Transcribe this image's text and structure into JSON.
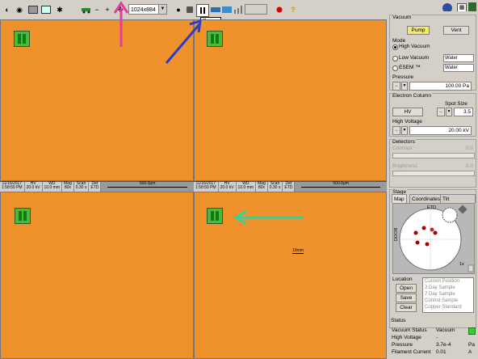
{
  "toolbar": {
    "resolution": "1024x884",
    "tooltip": "Pause",
    "icons": [
      "beam-icon",
      "eye-icon",
      "snapshot-icon",
      "image-icon",
      "settings-icon",
      "car-icon",
      "minus-icon",
      "plus-icon"
    ]
  },
  "quads": [
    {
      "databar": {
        "date": "11/16/2017",
        "time": "1:58:50 PM",
        "hv_h": "HV",
        "hv": "20.0 kV",
        "wd_h": "WD",
        "wd": "10.0 mm",
        "mag_h": "Mag",
        "mag": "80x",
        "scan_h": "Scan",
        "scan": "0.30 s",
        "det_h": "Det",
        "det": "ETD",
        "scale": "500.0μm"
      }
    },
    {
      "databar": {
        "date": "11/16/2017",
        "time": "1:58:50 PM",
        "hv_h": "HV",
        "hv": "20.0 kV",
        "wd_h": "WD",
        "wd": "10.0 mm",
        "mag_h": "Mag",
        "mag": "80x",
        "scan_h": "Scan",
        "scan": "0.30 s",
        "det_h": "Det",
        "det": "ETD",
        "scale": "500.0μm"
      }
    },
    {
      "overlay": "10mm"
    }
  ],
  "vacuum": {
    "title": "Vacuum",
    "pump": "Pump",
    "vent": "Vent",
    "mode_label": "Mode",
    "high_vacuum": "High Vacuum",
    "low_vacuum": "Low Vacuum",
    "esem": "ESEM ™",
    "water1": "Water",
    "water2": "Water",
    "pressure_label": "Pressure",
    "pressure": "100.00 Pa"
  },
  "electron_column": {
    "title": "Electron Column",
    "spot_label": "Spot Size",
    "hv_button": "HV",
    "spot": "3.5",
    "hv_label": "High Voltage",
    "hv_value": "20.00 kV"
  },
  "detectors": {
    "title": "Detectors",
    "contrast": "Contrast",
    "contrast_val": "0.0",
    "brightness": "Brightness",
    "brightness_val": "0.0"
  },
  "stage": {
    "title": "Stage",
    "tabs": [
      "Map",
      "Coordinates",
      "Tilt Correction"
    ],
    "etd": "ETD",
    "door": "DOOR",
    "zoom": "1x",
    "location_label": "Location",
    "open": "Open",
    "save": "Save",
    "clear": "Clear",
    "locations": [
      "Current Position",
      "2 Day Sample",
      "7 Day Sample",
      "Control Sample",
      "Copper Standard"
    ]
  },
  "status": {
    "title": "Status",
    "rows": [
      {
        "label": "Vacuum Status",
        "value": "Vacuum",
        "unit": ""
      },
      {
        "label": "High Voltage",
        "value": "-",
        "unit": ""
      },
      {
        "label": "Pressure",
        "value": "3.7e-4",
        "unit": "Pa"
      },
      {
        "label": "Filament Current",
        "value": "0.01",
        "unit": "A"
      }
    ]
  },
  "colors": {
    "screen": "#f0922c",
    "pause_green": "#4db83e",
    "status_ok": "#33cc33",
    "pink_arrow": "#e0409a",
    "blue_arrow": "#2a3ccc",
    "green_arrow": "#3ad09a"
  }
}
